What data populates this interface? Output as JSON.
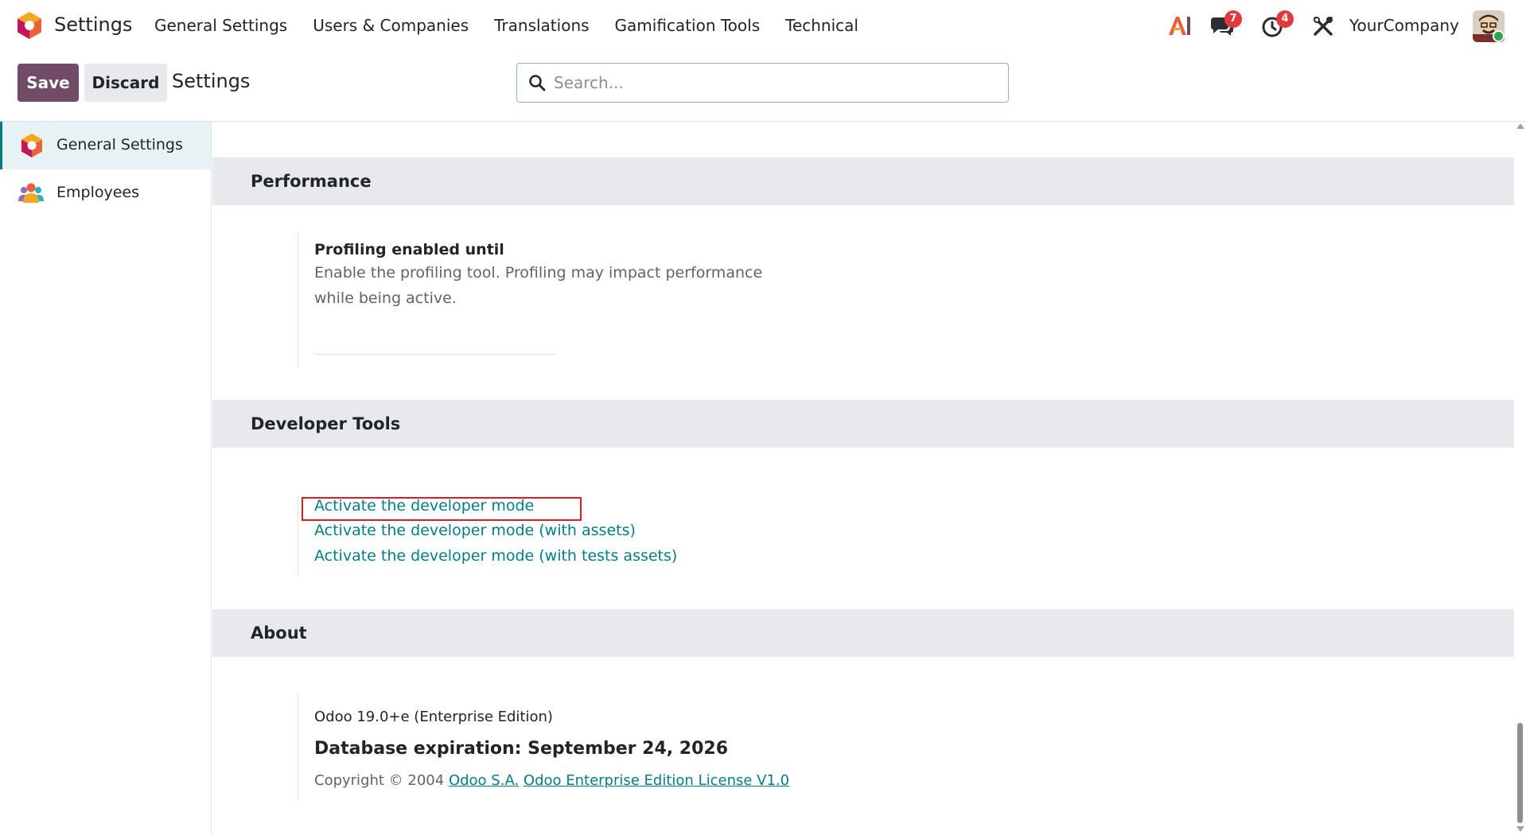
{
  "navbar": {
    "app_name": "Settings",
    "menu": [
      "General Settings",
      "Users & Companies",
      "Translations",
      "Gamification Tools",
      "Technical"
    ],
    "chat_badge": "7",
    "activity_badge": "4",
    "company": "YourCompany"
  },
  "control_panel": {
    "save_label": "Save",
    "discard_label": "Discard",
    "title": "Settings",
    "search_placeholder": "Search..."
  },
  "sidebar": {
    "items": [
      {
        "label": "General Settings",
        "active": true
      },
      {
        "label": "Employees",
        "active": false
      }
    ]
  },
  "sections": {
    "performance": {
      "title": "Performance",
      "setting_title": "Profiling enabled until",
      "setting_desc": "Enable the profiling tool. Profiling may impact performance while being active."
    },
    "developer_tools": {
      "title": "Developer Tools",
      "links": [
        "Activate the developer mode",
        "Activate the developer mode (with assets)",
        "Activate the developer mode (with tests assets)"
      ]
    },
    "about": {
      "title": "About",
      "version": "Odoo 19.0+e (Enterprise Edition)",
      "expiration": "Database expiration: September 24, 2026",
      "copyright": "Copyright © 2004",
      "company_link": "Odoo S.A.",
      "license_link": "Odoo Enterprise Edition License V1.0"
    }
  },
  "colors": {
    "brand": "#714b67",
    "link": "#017e84",
    "section_bg": "#e7e9ed",
    "highlight": "#e01b24",
    "badge": "#e03a3e"
  }
}
